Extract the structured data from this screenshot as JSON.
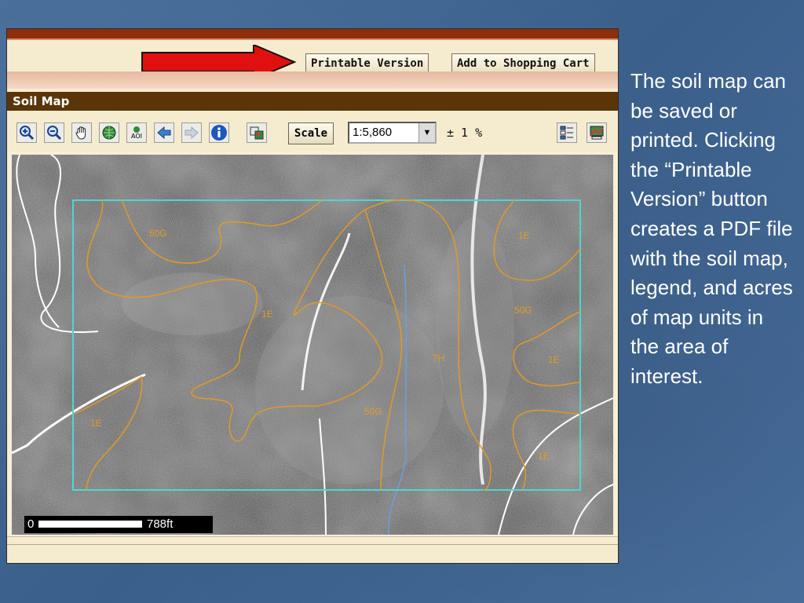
{
  "buttons": {
    "printable": "Printable Version",
    "cart": "Add to Shopping Cart"
  },
  "panel": {
    "title": "Soil Map"
  },
  "toolbar": {
    "scale_label": "Scale",
    "scale_value": "1:5,860",
    "tolerance": "± 1 %",
    "icons": [
      "zoom-in-icon",
      "zoom-out-icon",
      "pan-hand-icon",
      "globe-icon",
      "aoi-icon",
      "back-arrow-icon",
      "forward-arrow-icon",
      "info-icon",
      "identify-icon",
      "legend-icon",
      "map-layers-icon"
    ],
    "aoi_icon_text": "AOI"
  },
  "map": {
    "unit_labels": [
      "50G",
      "1E",
      "1E",
      "50G",
      "7H",
      "1E",
      "1E",
      "50G",
      "1E"
    ],
    "scale_bar": {
      "start": "0",
      "end": "788ft"
    },
    "colors": {
      "boundary": "#e09a28",
      "aoi": "#4fd6d0",
      "roads": "#ffffff",
      "stream": "#6aa0e0"
    }
  },
  "caption": "The soil map can be saved or printed. Clicking the “Printable Version” button creates a PDF file with the soil map, legend, and acres of map units in the area of interest."
}
